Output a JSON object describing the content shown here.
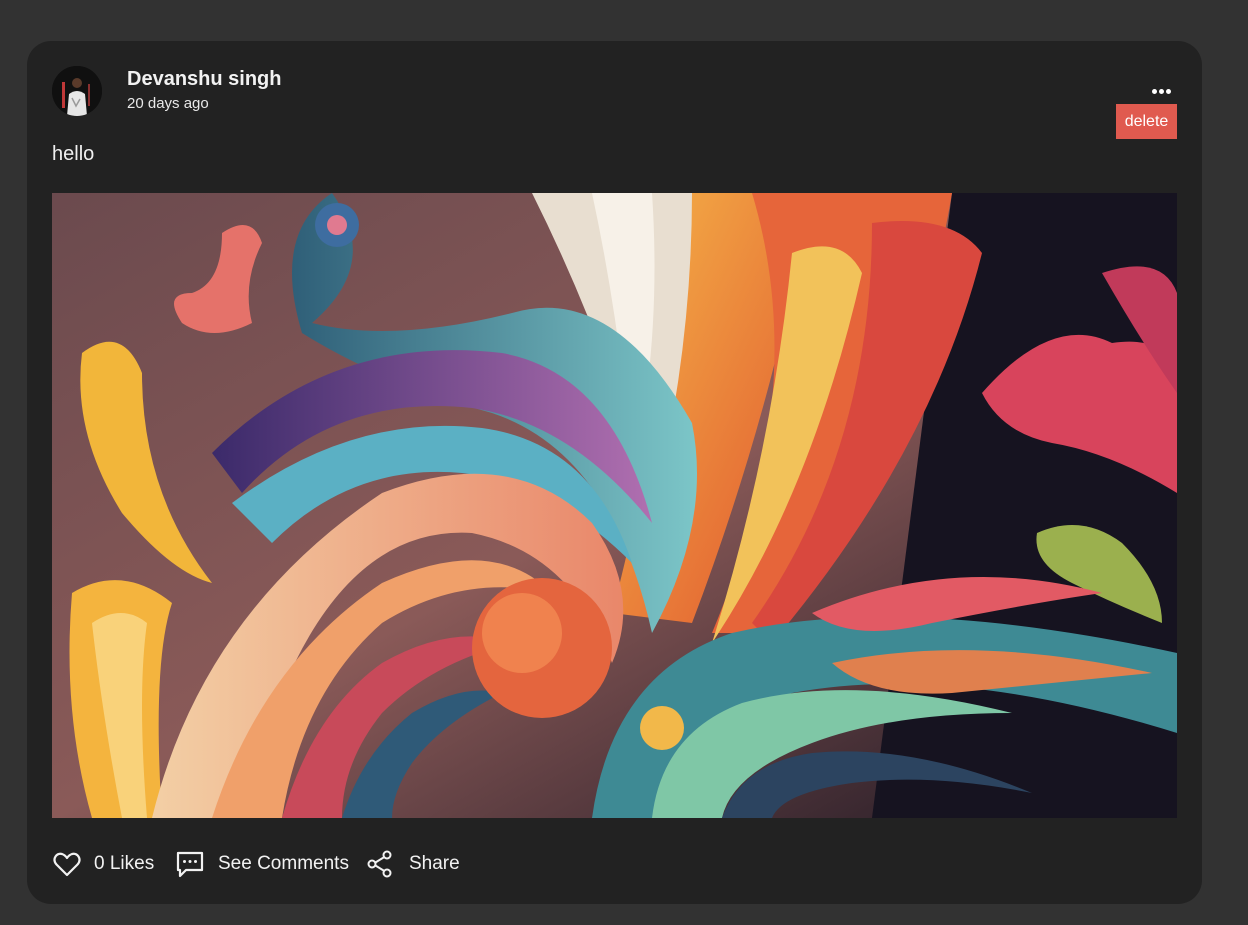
{
  "post": {
    "author": "Devanshu singh",
    "time": "20 days ago",
    "text": "hello",
    "delete_label": "delete"
  },
  "actions": {
    "likes_label": "0 Likes",
    "comments_label": "See Comments",
    "share_label": "Share"
  },
  "icons": {
    "more": "more-options-icon",
    "like": "heart-icon",
    "comments": "comment-icon",
    "share": "share-icon"
  },
  "colors": {
    "page_background": "#323232",
    "card_background": "#222222",
    "delete_button": "#e05a4f",
    "text": "#f2f2f2"
  }
}
